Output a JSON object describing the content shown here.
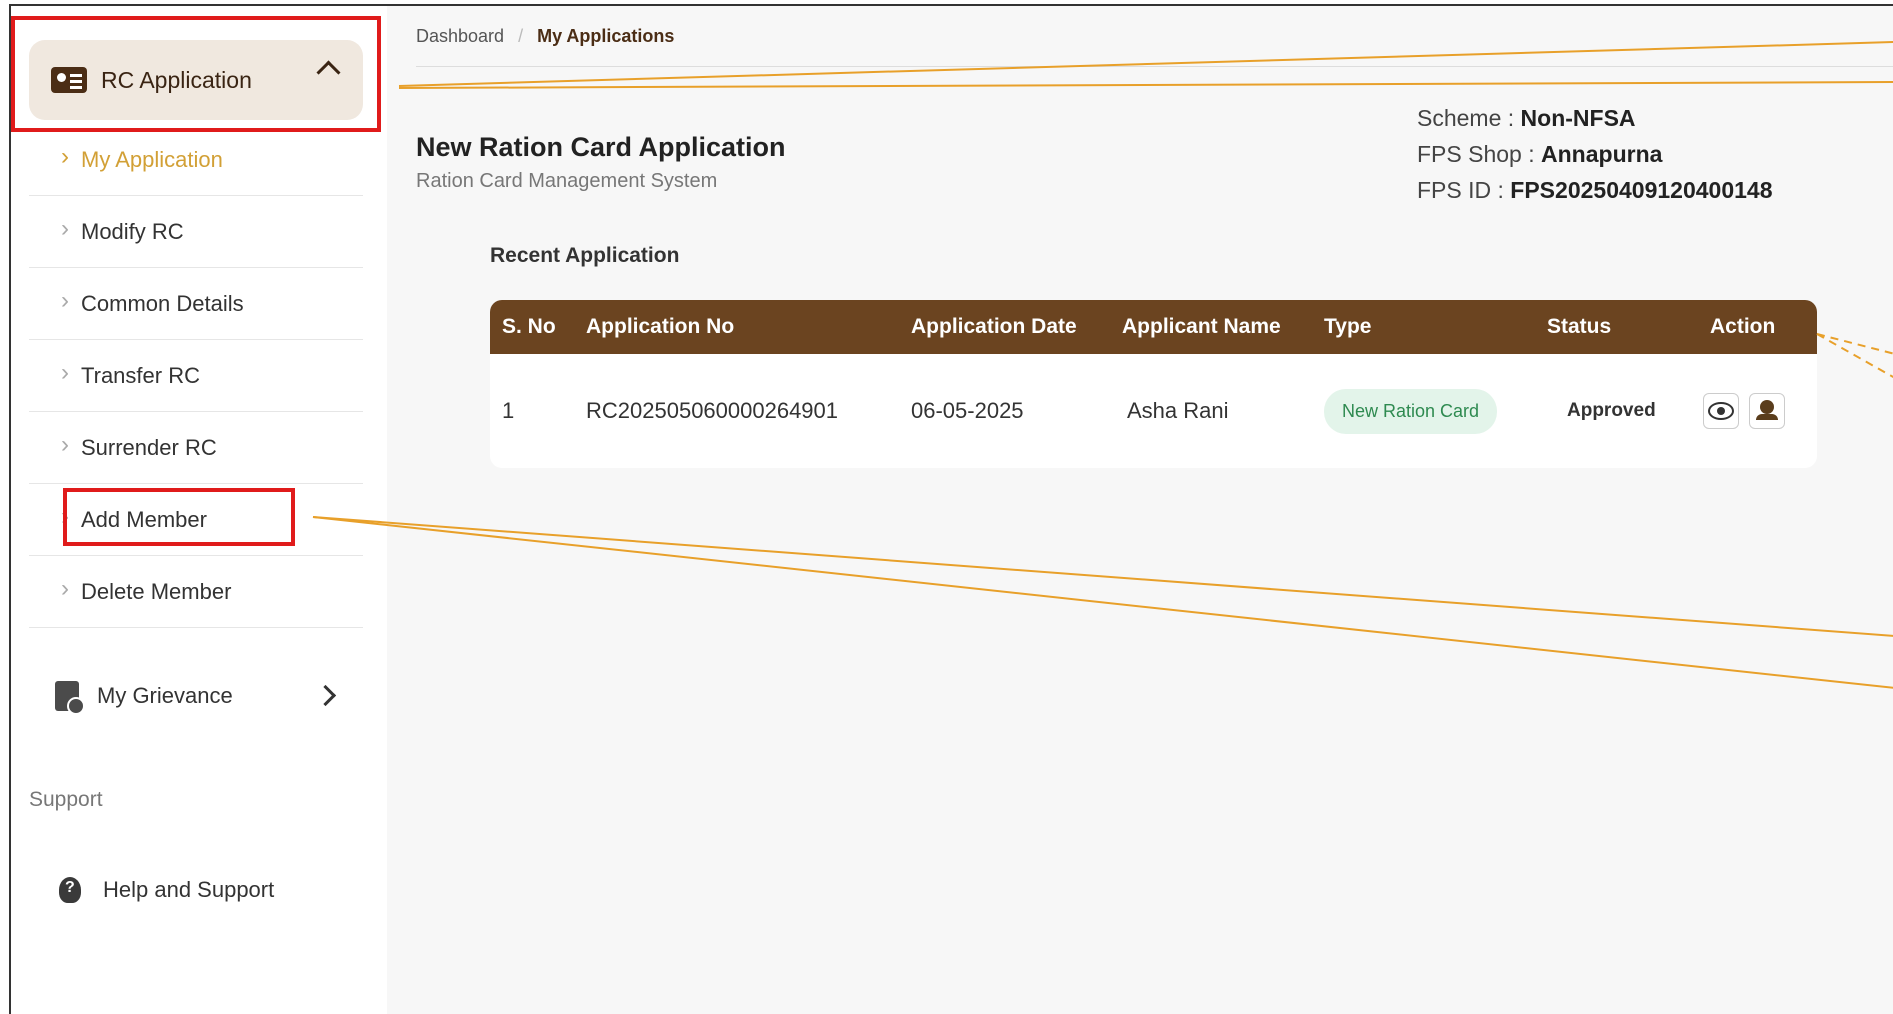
{
  "sidebar": {
    "rc_application": {
      "label": "RC Application",
      "icon": "id-card-icon"
    },
    "sub_items": [
      {
        "label": "My Application",
        "active": true
      },
      {
        "label": "Modify RC",
        "active": false
      },
      {
        "label": "Common Details",
        "active": false
      },
      {
        "label": "Transfer RC",
        "active": false
      },
      {
        "label": "Surrender RC",
        "active": false
      },
      {
        "label": "Add Member",
        "active": false
      },
      {
        "label": "Delete Member",
        "active": false
      }
    ],
    "grievance": {
      "label": "My Grievance",
      "icon": "grievance-icon"
    },
    "support_heading": "Support",
    "help": {
      "label": "Help and Support",
      "icon": "help-icon"
    }
  },
  "breadcrumb": {
    "home": "Dashboard",
    "separator": "/",
    "current": "My Applications"
  },
  "page": {
    "title": "New Ration Card Application",
    "subtitle": "Ration Card Management System"
  },
  "scheme_info": {
    "scheme_label": "Scheme :",
    "scheme_value": "Non-NFSA",
    "shop_label": "FPS Shop :",
    "shop_value": "Annapurna",
    "fps_id_label": "FPS ID :",
    "fps_id_value": "FPS20250409120400148"
  },
  "recent": {
    "heading": "Recent Application",
    "columns": [
      "S. No",
      "Application No",
      "Application Date",
      "Applicant Name",
      "Type",
      "Status",
      "Action"
    ],
    "rows": [
      {
        "sno": "1",
        "app_no": "RC202505060000264901",
        "date": "06-05-2025",
        "name": "Asha Rani",
        "type": "New Ration Card",
        "status": "Approved"
      }
    ]
  },
  "colors": {
    "brand_brown": "#6b4420",
    "accent_gold": "#d2a036",
    "highlight_red": "#e01b1b",
    "annotation_orange": "#e8a02a",
    "badge_green": "#2e8a50"
  }
}
